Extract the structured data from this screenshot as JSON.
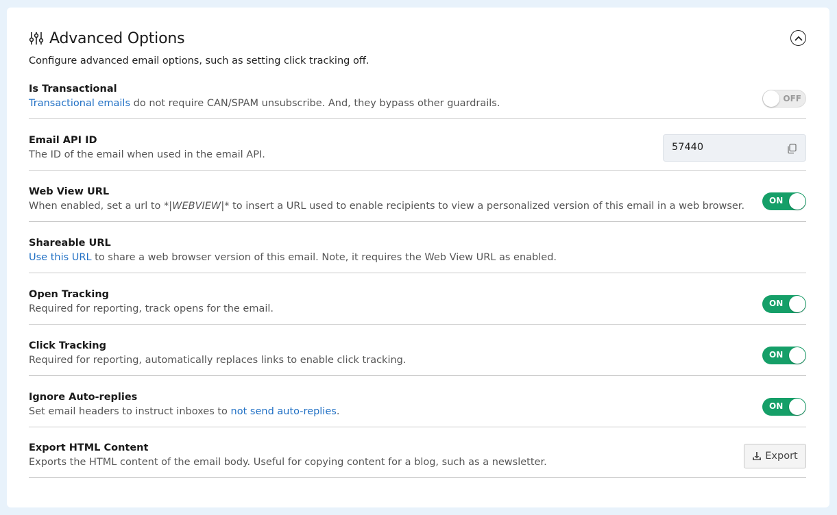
{
  "panel": {
    "title": "Advanced Options",
    "subtitle": "Configure advanced email options, such as setting click tracking off.",
    "header_icon": "sliders-icon",
    "collapse_icon": "chevron-up-circle-icon"
  },
  "rows": {
    "transactional": {
      "title": "Is Transactional",
      "link": "Transactional emails",
      "desc_rest": " do not require CAN/SPAM unsubscribe. And, they bypass other guardrails.",
      "toggle": "OFF"
    },
    "api_id": {
      "title": "Email API ID",
      "desc": "The ID of the email when used in the email API.",
      "value": "57440",
      "copy_icon": "copy-icon"
    },
    "webview": {
      "title": "Web View URL",
      "desc_pre": "When enabled, set a url to ",
      "code": "*|WEBVIEW|*",
      "desc_post": " to insert a URL used to enable recipients to view a personalized version of this email in a web browser.",
      "toggle": "ON"
    },
    "shareable": {
      "title": "Shareable URL",
      "link": "Use this URL",
      "desc_rest": " to share a web browser version of this email. Note, it requires the Web View URL as enabled."
    },
    "open_tracking": {
      "title": "Open Tracking",
      "desc": "Required for reporting, track opens for the email.",
      "toggle": "ON"
    },
    "click_tracking": {
      "title": "Click Tracking",
      "desc": "Required for reporting, automatically replaces links to enable click tracking.",
      "toggle": "ON"
    },
    "auto_replies": {
      "title": "Ignore Auto-replies",
      "desc_pre": "Set email headers to instruct inboxes to ",
      "link": "not send auto-replies",
      "desc_post": ".",
      "toggle": "ON"
    },
    "export_html": {
      "title": "Export HTML Content",
      "desc": "Exports the HTML content of the email body. Useful for copying content for a blog, such as a newsletter.",
      "button_label": "Export",
      "button_icon": "download-icon"
    }
  },
  "colors": {
    "toggle_on": "#159f68",
    "link": "#1f6fc4",
    "page_bg": "#e8f2fb"
  }
}
